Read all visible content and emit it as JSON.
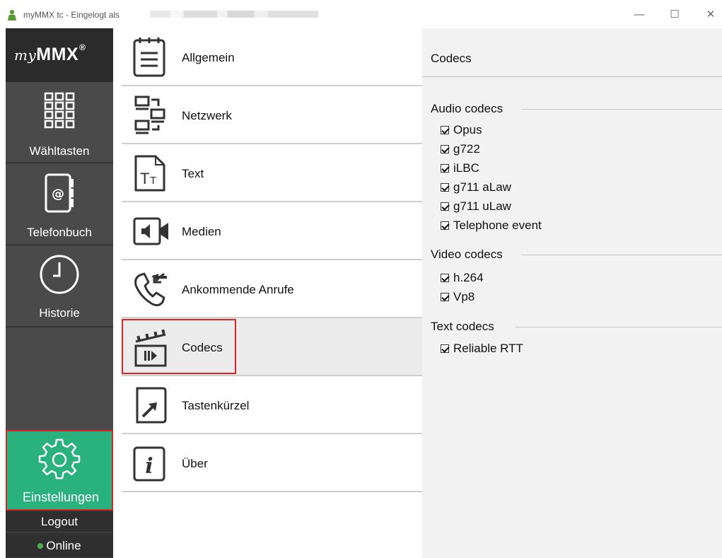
{
  "window": {
    "title": "myMMX tc - Eingelogt als",
    "controls": {
      "minimize": "—",
      "maximize": "☐",
      "close": "✕"
    }
  },
  "sidebar": {
    "brand_prefix": "my",
    "brand_main": "MMX",
    "brand_reg": "®",
    "items": [
      {
        "label": "Wähltasten",
        "icon": "dialpad-icon"
      },
      {
        "label": "Telefonbuch",
        "icon": "phonebook-icon"
      },
      {
        "label": "Historie",
        "icon": "clock-icon"
      },
      {
        "label": "Einstellungen",
        "icon": "gear-icon",
        "active": true
      }
    ],
    "logout": "Logout",
    "status": "Online",
    "status_color": "#4caf50",
    "active_color": "#29b27e"
  },
  "menu": {
    "items": [
      {
        "label": "Allgemein",
        "icon": "notepad-icon"
      },
      {
        "label": "Netzwerk",
        "icon": "network-icon"
      },
      {
        "label": "Text",
        "icon": "text-icon"
      },
      {
        "label": "Medien",
        "icon": "media-icon"
      },
      {
        "label": "Ankommende Anrufe",
        "icon": "incoming-call-icon"
      },
      {
        "label": "Codecs",
        "icon": "clapperboard-icon",
        "selected": true
      },
      {
        "label": "Tastenkürzel",
        "icon": "shortcut-icon"
      },
      {
        "label": "Über",
        "icon": "info-icon"
      }
    ]
  },
  "panel": {
    "title": "Codecs",
    "groups": [
      {
        "title": "Audio codecs",
        "items": [
          "Opus",
          "g722",
          "iLBC",
          "g711 aLaw",
          "g711 uLaw",
          "Telephone event"
        ]
      },
      {
        "title": "Video codecs",
        "items": [
          "h.264",
          "Vp8"
        ]
      },
      {
        "title": "Text codecs",
        "items": [
          "Reliable RTT"
        ]
      }
    ]
  }
}
